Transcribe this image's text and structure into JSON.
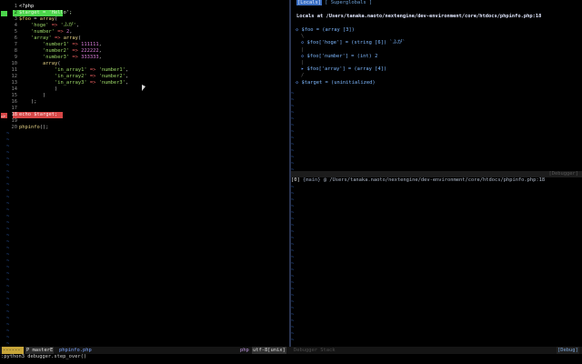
{
  "editor": {
    "lines": [
      {
        "n": "1",
        "parts": [
          [
            "php",
            "<?php"
          ]
        ]
      },
      {
        "n": "2",
        "hl": "green",
        "gutter": "green",
        "parts": [
          [
            "plain",
            "$target = 'Hello';"
          ]
        ]
      },
      {
        "n": "3",
        "parts": [
          [
            "var",
            "$foo"
          ],
          [
            "plain",
            " = "
          ],
          [
            "fn",
            "array"
          ],
          [
            "plain",
            "("
          ]
        ]
      },
      {
        "n": "4",
        "parts": [
          [
            "plain",
            "    "
          ],
          [
            "str",
            "'hoge'"
          ],
          [
            "op",
            " => "
          ],
          [
            "str",
            "'ふが'"
          ],
          [
            "plain",
            ","
          ]
        ]
      },
      {
        "n": "5",
        "parts": [
          [
            "plain",
            "    "
          ],
          [
            "str",
            "'number'"
          ],
          [
            "op",
            " => "
          ],
          [
            "num",
            "2"
          ],
          [
            "plain",
            ","
          ]
        ]
      },
      {
        "n": "6",
        "parts": [
          [
            "plain",
            "    "
          ],
          [
            "str",
            "'array'"
          ],
          [
            "op",
            " => "
          ],
          [
            "fn",
            "array"
          ],
          [
            "plain",
            "("
          ]
        ]
      },
      {
        "n": "7",
        "parts": [
          [
            "plain",
            "        "
          ],
          [
            "str",
            "'number1'"
          ],
          [
            "op",
            " => "
          ],
          [
            "num",
            "111111"
          ],
          [
            "plain",
            ","
          ]
        ]
      },
      {
        "n": "8",
        "parts": [
          [
            "plain",
            "        "
          ],
          [
            "str",
            "'number2'"
          ],
          [
            "op",
            " => "
          ],
          [
            "num",
            "222222"
          ],
          [
            "plain",
            ","
          ]
        ]
      },
      {
        "n": "9",
        "parts": [
          [
            "plain",
            "        "
          ],
          [
            "str",
            "'number3'"
          ],
          [
            "op",
            " => "
          ],
          [
            "num",
            "333333"
          ],
          [
            "plain",
            ","
          ]
        ]
      },
      {
        "n": "10",
        "parts": [
          [
            "plain",
            "        "
          ],
          [
            "fn",
            "array"
          ],
          [
            "plain",
            "("
          ]
        ]
      },
      {
        "n": "11",
        "parts": [
          [
            "plain",
            "            "
          ],
          [
            "str",
            "'in_array1'"
          ],
          [
            "op",
            " => "
          ],
          [
            "str",
            "'number1'"
          ],
          [
            "plain",
            ","
          ]
        ]
      },
      {
        "n": "12",
        "parts": [
          [
            "plain",
            "            "
          ],
          [
            "str",
            "'in_array2'"
          ],
          [
            "op",
            " => "
          ],
          [
            "str",
            "'number2'"
          ],
          [
            "plain",
            ","
          ]
        ]
      },
      {
        "n": "13",
        "parts": [
          [
            "plain",
            "            "
          ],
          [
            "str",
            "'in_array3'"
          ],
          [
            "op",
            " => "
          ],
          [
            "str",
            "'number3'"
          ],
          [
            "plain",
            ","
          ]
        ]
      },
      {
        "n": "14",
        "parts": [
          [
            "plain",
            "            )"
          ]
        ]
      },
      {
        "n": "15",
        "parts": [
          [
            "plain",
            "        )"
          ]
        ]
      },
      {
        "n": "16",
        "parts": [
          [
            "plain",
            "    );"
          ]
        ]
      },
      {
        "n": "17",
        "parts": [
          [
            "plain",
            ""
          ]
        ]
      },
      {
        "n": "18",
        "hl": "red",
        "gutter": "red",
        "gutter_text": "=>",
        "parts": [
          [
            "plain",
            "echo $target;"
          ]
        ]
      },
      {
        "n": "19",
        "parts": [
          [
            "plain",
            ""
          ]
        ]
      },
      {
        "n": "20",
        "parts": [
          [
            "fn",
            "phpinfo"
          ],
          [
            "plain",
            "();"
          ]
        ]
      }
    ]
  },
  "right_top": {
    "tab_label": "[Locals]",
    "tab_rest": "[ Superglobals ]"
  },
  "locals": {
    "header": "Locals at /Users/tanaka.naoto/nextengine/dev-environment/core/htdocs/phpinfo.php:18",
    "entries": [
      {
        "indent": 0,
        "mark": "◇",
        "conn": "",
        "text": "$foo = (array [3])"
      },
      {
        "indent": 1,
        "mark": "",
        "conn": "\\",
        "text": ""
      },
      {
        "indent": 1,
        "mark": "◇",
        "conn": "",
        "text": "$foo['hoge'] = (string [6]) `ふが`"
      },
      {
        "indent": 1,
        "mark": "",
        "conn": "|",
        "text": ""
      },
      {
        "indent": 1,
        "mark": "◇",
        "conn": "",
        "text": "$foo['number'] = (int) 2"
      },
      {
        "indent": 1,
        "mark": "",
        "conn": "|",
        "text": ""
      },
      {
        "indent": 1,
        "mark": "▸",
        "conn": "",
        "text": "$foo['array'] = (array [4])"
      },
      {
        "indent": 1,
        "mark": "",
        "conn": "/",
        "text": ""
      },
      {
        "indent": 0,
        "mark": "◇",
        "conn": "",
        "text": "$target = (uninitialized)"
      }
    ]
  },
  "stack": {
    "index": "[0]",
    "frame": "{main}",
    "path": "@ /Users/tanaka.naoto/nextengine/dev-environment/core/htdocs/phpinfo.php:18"
  },
  "split_label_top": "[Debugger]",
  "statusline": {
    "mode": "------",
    "branch_icon": "P",
    "branch": "master",
    "branch_flag": "E",
    "file": "phpinfo.php",
    "filetype": "php",
    "encoding": "utf-8[unix]",
    "right_label": "Debugger Stack",
    "right_mode": "[Debug]"
  },
  "cmdline": ":python3 debugger.step_over()"
}
